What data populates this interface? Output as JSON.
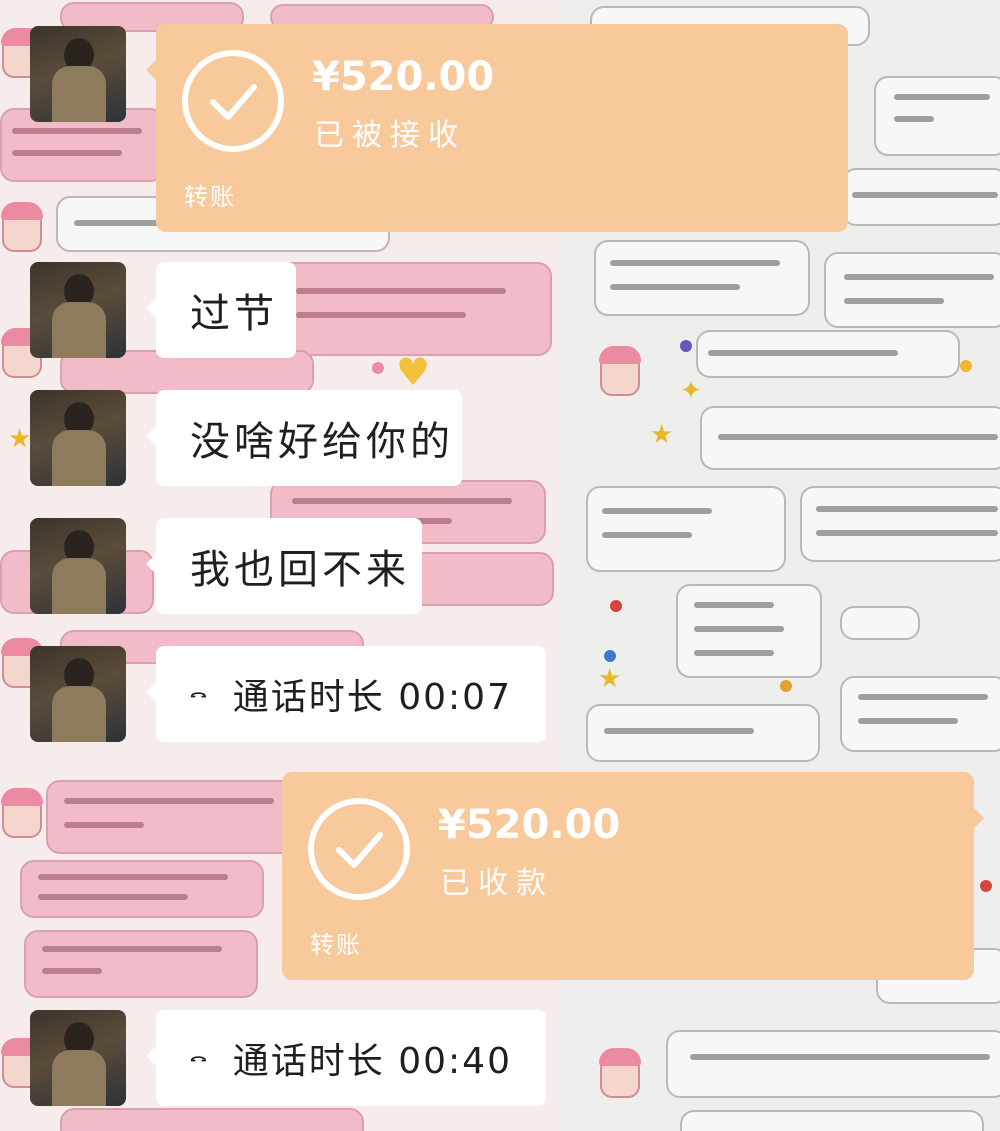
{
  "messages": {
    "transfer_1": {
      "amount": "¥520.00",
      "status": "已被接收",
      "label": "转账"
    },
    "text_1": "过节",
    "text_2": "没啥好给你的",
    "text_3": "我也回不来",
    "call_1": "通话时长 00:07",
    "transfer_2": {
      "amount": "¥520.00",
      "status": "已收款",
      "label": "转账"
    },
    "call_2": "通话时长 00:40"
  },
  "icons": {
    "check": "check-circle-icon",
    "phone": "phone-hangup-icon"
  },
  "colors": {
    "transfer_bubble": "#f8c99a",
    "text_bubble": "#ffffff"
  }
}
